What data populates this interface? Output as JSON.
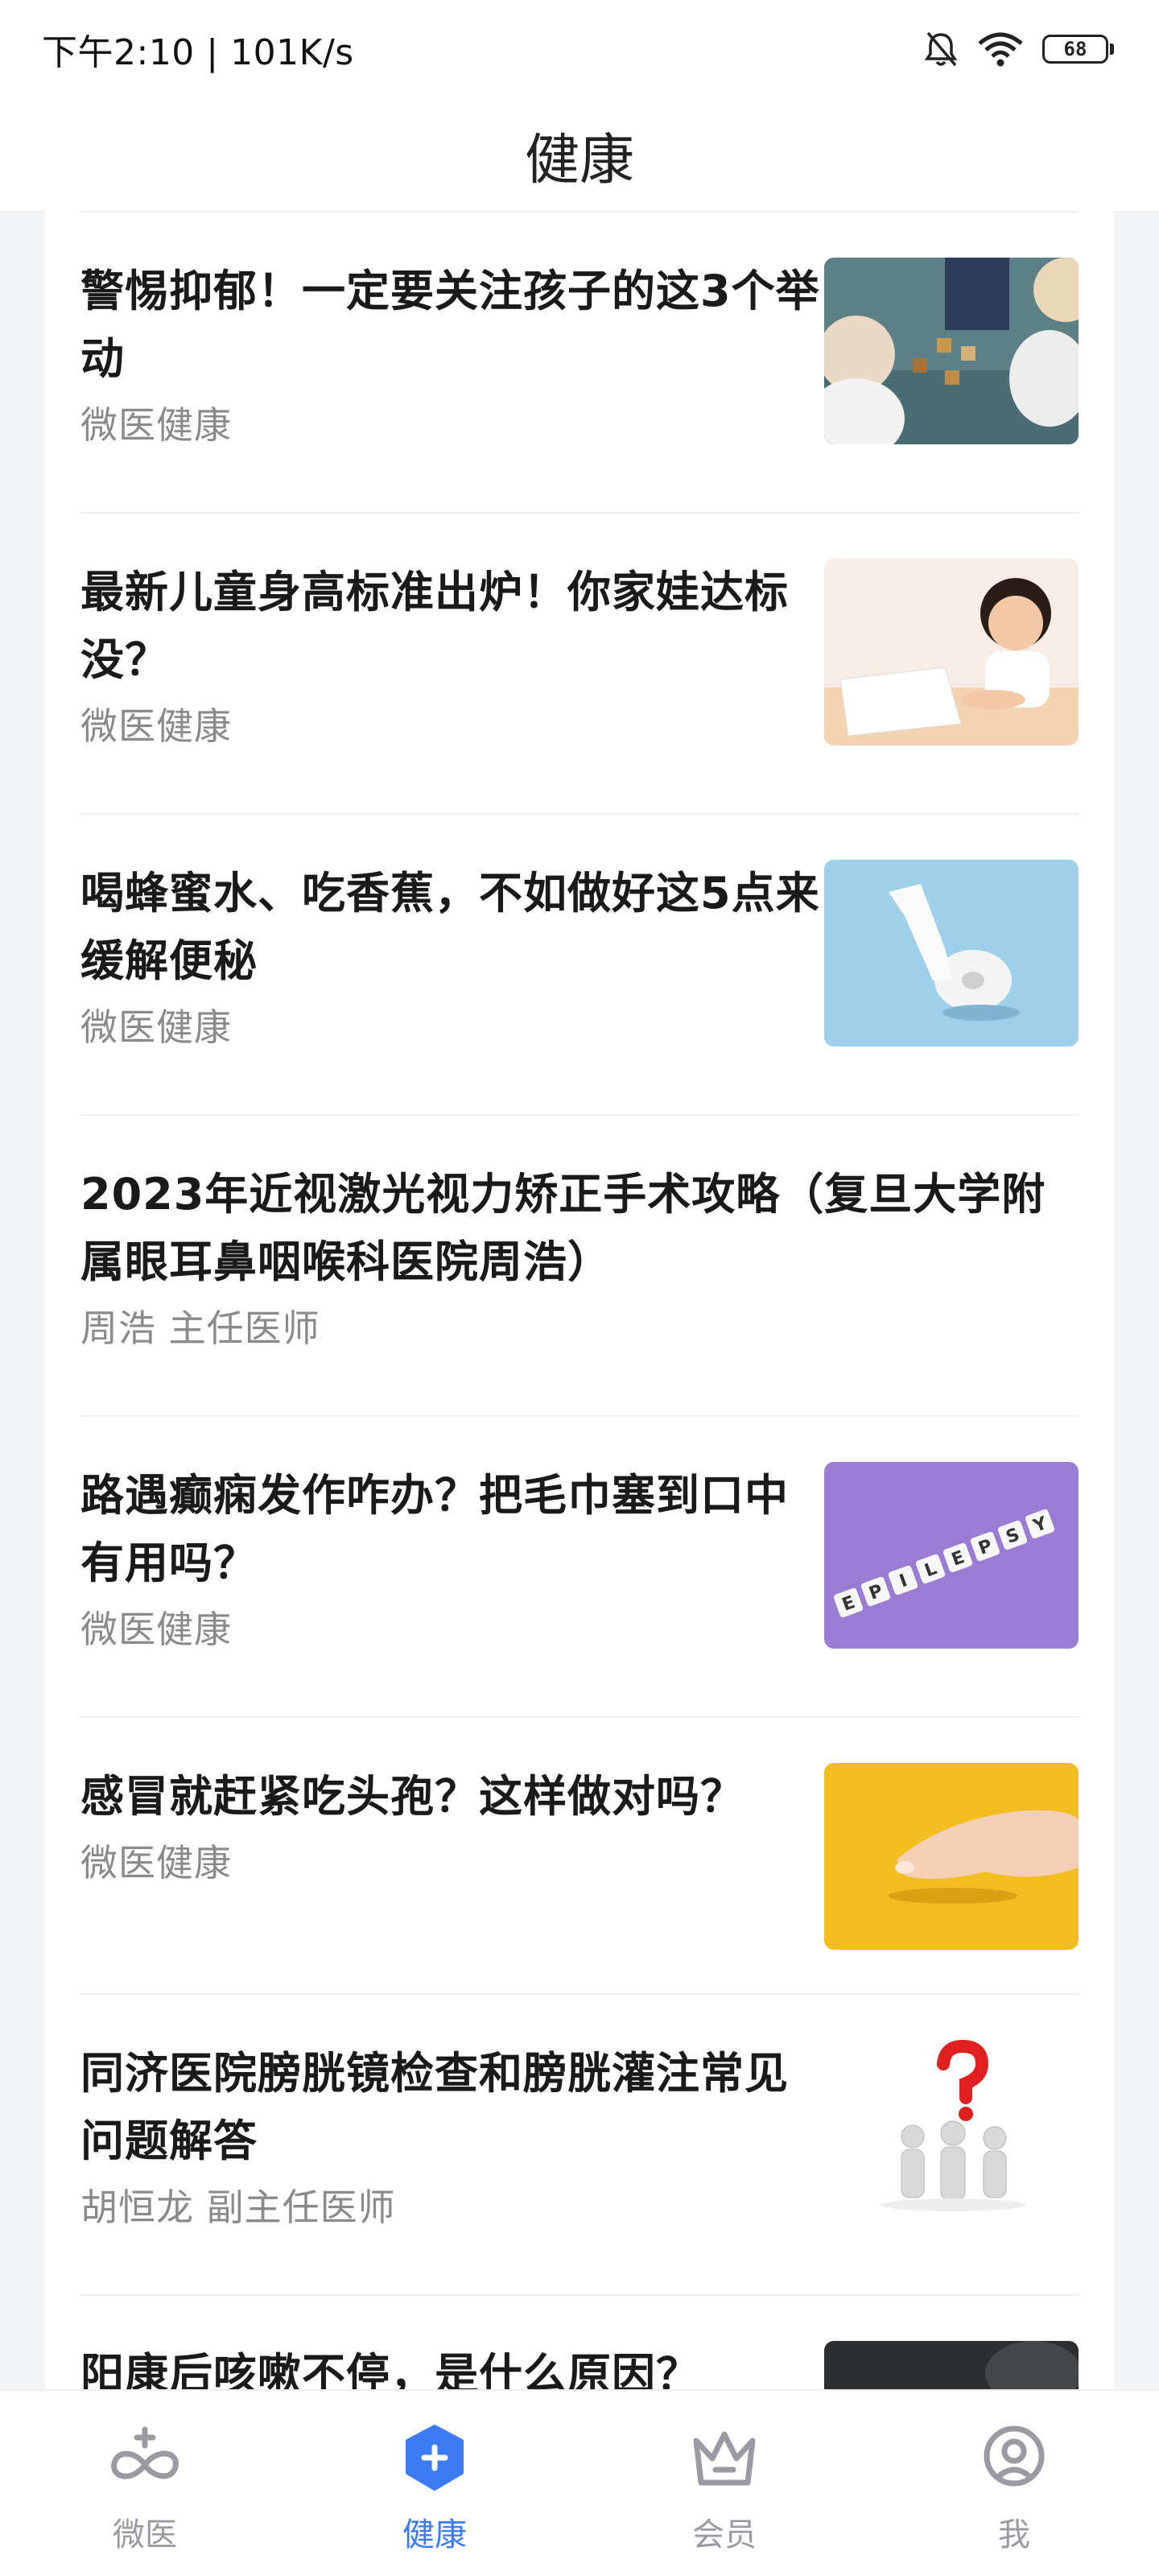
{
  "status_bar": {
    "time_speed": "下午2:10 | 101K/s",
    "battery": "68"
  },
  "header": {
    "title": "健康"
  },
  "articles": [
    {
      "title": "警惕抑郁！一定要关注孩子的这3个举动",
      "source": "微医健康",
      "thumb": "kids-playing-blocks-photo"
    },
    {
      "title": "最新儿童身高标准出炉！你家娃达标没？",
      "source": "微医健康",
      "thumb": "smiling-girl-at-desk-photo"
    },
    {
      "title": "喝蜂蜜水、吃香蕉，不如做好这5点来缓解便秘",
      "source": "微医健康",
      "thumb": "toilet-paper-roll-photo"
    },
    {
      "title": "2023年近视激光视力矫正手术攻略（复旦大学附属眼耳鼻咽喉科医院周浩）",
      "source": "周浩  主任医师",
      "thumb": ""
    },
    {
      "title": "路遇癫痫发作咋办？把毛巾塞到口中有用吗？",
      "source": "微医健康",
      "thumb": "epilepsy-letter-blocks-photo",
      "thumb_text": "EPILEPSY"
    },
    {
      "title": "感冒就赶紧吃头孢？这样做对吗？",
      "source": "微医健康",
      "thumb": "hand-on-yellow-photo"
    },
    {
      "title": "同济医院膀胱镜检查和膀胱灌注常见问题解答",
      "source": "胡恒龙  副主任医师",
      "thumb": "question-mark-figures-illustration"
    },
    {
      "title": "阳康后咳嗽不停，是什么原因？",
      "source": "",
      "thumb": "dark-photo"
    }
  ],
  "tab_bar": {
    "tabs": [
      {
        "label": "微医",
        "icon": "weiyi-infinity-icon"
      },
      {
        "label": "健康",
        "icon": "health-shield-plus-icon",
        "active": true
      },
      {
        "label": "会员",
        "icon": "crown-icon"
      },
      {
        "label": "我",
        "icon": "person-icon"
      }
    ]
  },
  "colors": {
    "accent": "#3b7cf5",
    "inactive": "#9a9aa2",
    "background": "#f3f4f6"
  }
}
